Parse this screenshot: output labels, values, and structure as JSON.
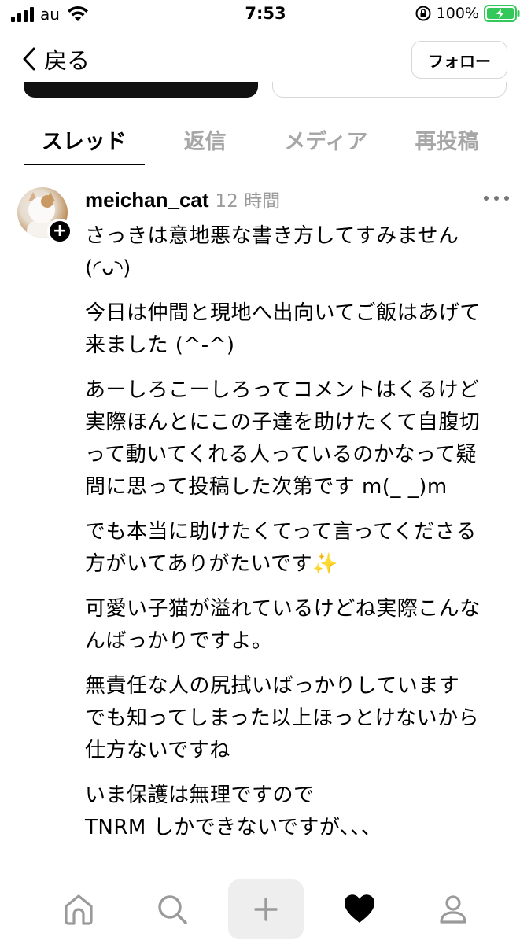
{
  "status_bar": {
    "carrier": "au",
    "time": "7:53",
    "battery_percent": "100%"
  },
  "header": {
    "back_label": "戻る",
    "follow_label": "フォロー"
  },
  "tabs": [
    {
      "label": "スレッド",
      "active": true
    },
    {
      "label": "返信",
      "active": false
    },
    {
      "label": "メディア",
      "active": false
    },
    {
      "label": "再投稿",
      "active": false
    }
  ],
  "post": {
    "username": "meichan_cat",
    "timestamp": "12 時間",
    "paragraphs": [
      [
        "さっきは意地悪な書き方してすみません",
        "(◜ᴗ◝)"
      ],
      [
        "今日は仲間と現地へ出向いてご飯はあげて",
        "来ました (^-^)"
      ],
      [
        "あーしろこーしろってコメントはくるけど",
        "実際ほんとにこの子達を助けたくて自腹切",
        "って動いてくれる人っているのかなって疑",
        "問に思って投稿した次第です m(_ _)m"
      ],
      [
        "でも本当に助けたくてって言ってくださる",
        "方がいてありがたいです"
      ],
      [
        "可愛い子猫が溢れているけどね実際こんな",
        "んばっかりですよ。"
      ],
      [
        "無責任な人の尻拭いばっかりしています",
        "でも知ってしまった以上ほっとけないから",
        "仕方ないですね"
      ],
      [
        "いま保護は無理ですので",
        "TNRM しかできないですが、、、"
      ]
    ],
    "sparkles_emoji": "✨"
  },
  "bottom_nav": {
    "items": [
      "home-icon",
      "search-icon",
      "create-icon",
      "activity-heart-icon",
      "profile-icon"
    ]
  },
  "colors": {
    "text": "#000000",
    "muted": "#9b9b9b",
    "inactive_tab": "#a7a7a7",
    "divider": "#e3e3e3",
    "battery_green": "#34c759"
  }
}
